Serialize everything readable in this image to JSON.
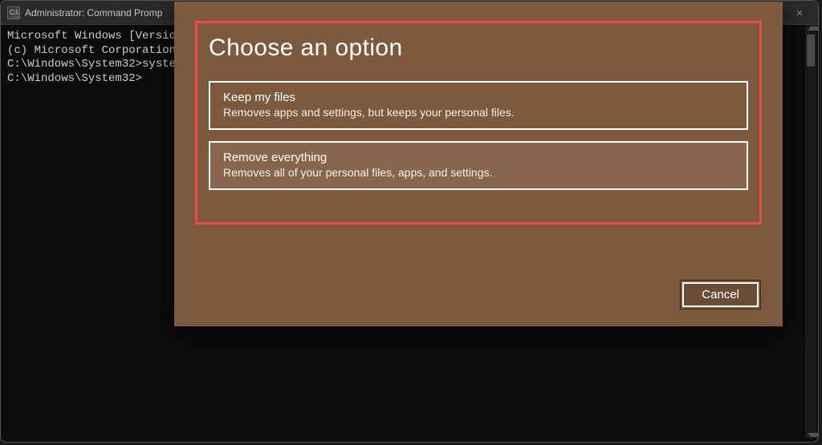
{
  "window": {
    "title": "Administrator: Command Promp",
    "icon_label": "cmd-icon"
  },
  "terminal": {
    "line1": "Microsoft Windows [Versio",
    "line2": "(c) Microsoft Corporation",
    "line3": "",
    "line4": "C:\\Windows\\System32>syste",
    "line5": "",
    "line6": "C:\\Windows\\System32>"
  },
  "dialog": {
    "title": "Choose an option",
    "options": [
      {
        "title": "Keep my files",
        "description": "Removes apps and settings, but keeps your personal files."
      },
      {
        "title": "Remove everything",
        "description": "Removes all of your personal files, apps, and settings."
      }
    ],
    "cancel": "Cancel"
  },
  "colors": {
    "dialog_bg": "#7d5a3e",
    "highlight_border": "#ea4b4b"
  }
}
